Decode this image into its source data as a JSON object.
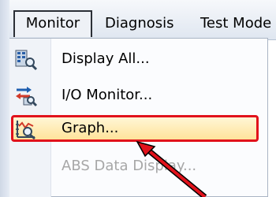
{
  "menubar": {
    "items": [
      {
        "label": "Monitor"
      },
      {
        "label": "Diagnosis"
      },
      {
        "label": "Test Mode"
      }
    ]
  },
  "dropdown": {
    "items": [
      {
        "label": "Display All...",
        "icon": "display-all-icon",
        "enabled": true
      },
      {
        "label": "I/O Monitor...",
        "icon": "io-monitor-icon",
        "enabled": true
      },
      {
        "label": "Graph...",
        "icon": "graph-icon",
        "enabled": true,
        "highlighted": true
      },
      {
        "label": "ABS Data Display...",
        "icon": "",
        "enabled": false
      }
    ]
  },
  "colors": {
    "highlight_border": "#e1121b",
    "highlight_fill": "#ffe39a",
    "arrow": "#e1121b"
  }
}
